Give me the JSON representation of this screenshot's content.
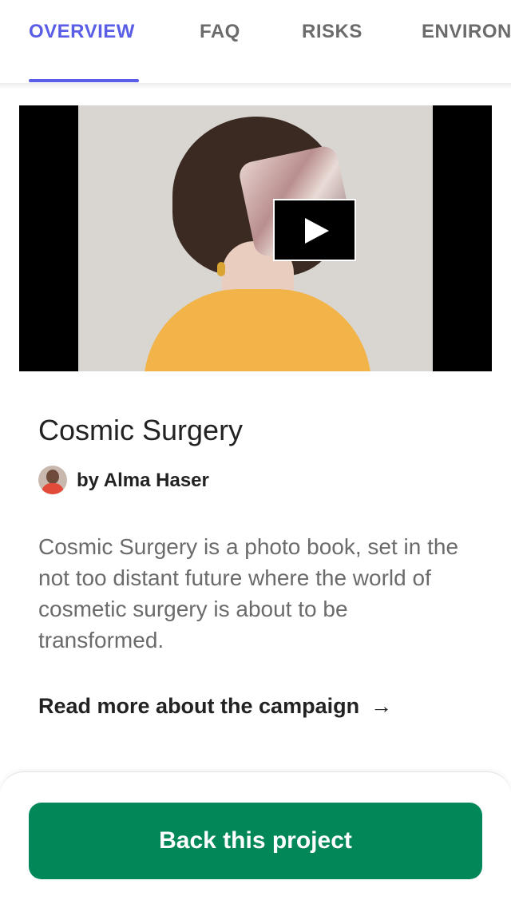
{
  "tabs": [
    {
      "label": "OVERVIEW",
      "active": true
    },
    {
      "label": "FAQ",
      "active": false
    },
    {
      "label": "RISKS",
      "active": false
    },
    {
      "label": "ENVIRONMENTAL COMMITMENTS",
      "active": false
    }
  ],
  "colors": {
    "accent": "#5a5ee6",
    "button": "#028858",
    "text_muted": "#6b6b6b"
  },
  "video": {
    "play_icon": "play-icon"
  },
  "project": {
    "title": "Cosmic Surgery",
    "creator": "by Alma Haser",
    "description": "Cosmic Surgery is a photo book, set in the not too distant future where the world of cosmetic surgery is about to be transformed.",
    "read_more": "Read more about the campaign",
    "read_more_icon": "arrow-right-icon"
  },
  "cta": {
    "label": "Back this project"
  }
}
